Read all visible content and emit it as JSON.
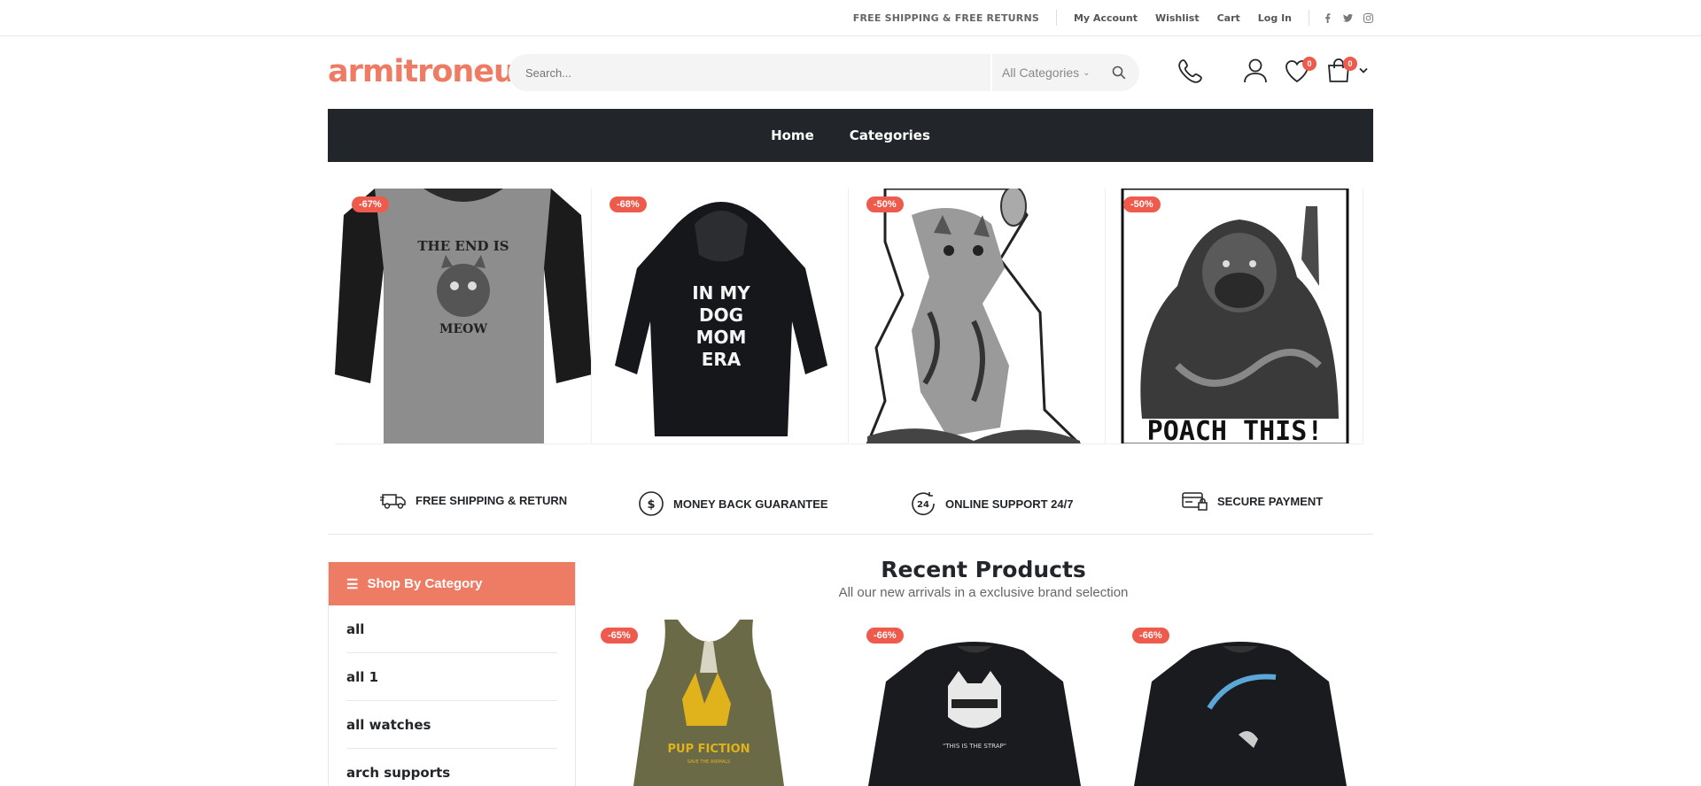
{
  "topbar": {
    "promo": "FREE SHIPPING & FREE RETURNS",
    "links": [
      "My Account",
      "Wishlist",
      "Cart",
      "Log In"
    ],
    "social": [
      "facebook-icon",
      "twitter-icon",
      "instagram-icon"
    ]
  },
  "header": {
    "logo": "armitroneur",
    "search_placeholder": "Search...",
    "category_select": "All Categories",
    "wishlist_count": "0",
    "cart_count": "0"
  },
  "nav": {
    "items": [
      "Home",
      "Categories"
    ]
  },
  "featured": [
    {
      "badge": "-67%",
      "image": "raglan tee - The End Is Meow"
    },
    {
      "badge": "-68%",
      "image": "black hoodie - In My Dog Mom Era"
    },
    {
      "badge": "-50%",
      "image": "cat grenade sticker"
    },
    {
      "badge": "-50%",
      "image": "gorilla - POACH THIS!"
    }
  ],
  "features": [
    {
      "label": "FREE SHIPPING & RETURN",
      "icon": "truck-icon"
    },
    {
      "label": "MONEY BACK GUARANTEE",
      "icon": "dollar-icon"
    },
    {
      "label": "ONLINE SUPPORT 24/7",
      "icon": "support-24-icon"
    },
    {
      "label": "SECURE PAYMENT",
      "icon": "secure-payment-icon"
    }
  ],
  "sidebar": {
    "title": "Shop By Category",
    "items": [
      "all",
      "all 1",
      "all watches",
      "arch supports"
    ]
  },
  "recent": {
    "title": "Recent Products",
    "subtitle": "All our new arrivals in a exclusive brand selection",
    "products": [
      {
        "badge": "-65%"
      },
      {
        "badge": "-66%"
      },
      {
        "badge": "-66%"
      }
    ]
  },
  "colors": {
    "accent": "#ee7b64",
    "badge": "#ee5a4c",
    "nav_bg": "#222529"
  }
}
